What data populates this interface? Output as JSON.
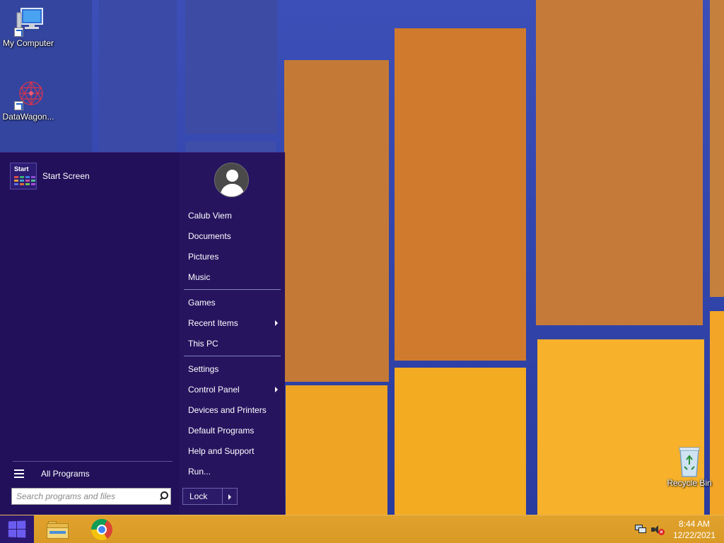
{
  "desktop": {
    "icons": [
      {
        "label": "My Computer"
      },
      {
        "label": "DataWagon..."
      },
      {
        "label": "Recycle Bin"
      }
    ]
  },
  "start_menu": {
    "pinned": {
      "tile_text": "Start",
      "label": "Start Screen"
    },
    "all_programs_label": "All Programs",
    "search": {
      "placeholder": "Search programs and files",
      "value": ""
    },
    "user_name": "Calub Viem",
    "right_items": [
      {
        "label": "Documents"
      },
      {
        "label": "Pictures"
      },
      {
        "label": "Music"
      },
      {
        "label": "Games"
      },
      {
        "label": "Recent Items",
        "has_submenu": true
      },
      {
        "label": "This PC"
      },
      {
        "label": "Settings"
      },
      {
        "label": "Control Panel",
        "has_submenu": true
      },
      {
        "label": "Devices and Printers"
      },
      {
        "label": "Default Programs"
      },
      {
        "label": "Help and Support"
      },
      {
        "label": "Run..."
      }
    ],
    "power_button_label": "Lock"
  },
  "taskbar": {
    "start_icon": "windows-logo-icon",
    "pinned_apps": [
      "file-explorer-icon",
      "chrome-icon"
    ],
    "tray_icons": [
      "network-icon",
      "volume-muted-icon"
    ],
    "clock": {
      "time": "8:44 AM",
      "date": "12/22/2021"
    }
  },
  "colors": {
    "start_menu_bg": "#22105a",
    "taskbar_bg": "#dc9e28",
    "start_button_bg": "#2b1770",
    "windows_logo": "#6b5cf0"
  }
}
